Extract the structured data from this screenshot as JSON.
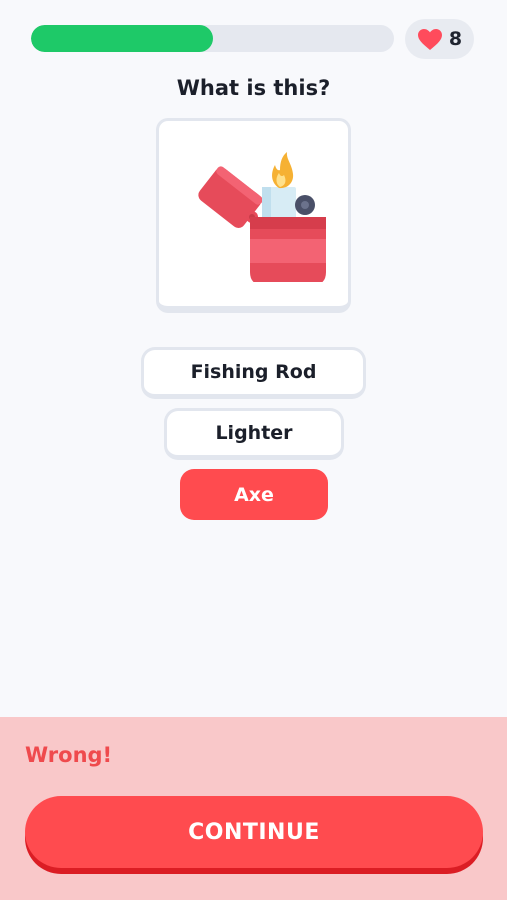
{
  "progress": {
    "fraction": 0.5,
    "fill_color": "#1ec968"
  },
  "lives": {
    "icon": "heart-icon",
    "count": "8"
  },
  "question": {
    "text": "What is this?"
  },
  "image": {
    "icon": "lighter-icon"
  },
  "answers": [
    {
      "label": "Fishing Rod",
      "state": "neutral"
    },
    {
      "label": "Lighter",
      "state": "neutral"
    },
    {
      "label": "Axe",
      "state": "wrong"
    }
  ],
  "feedback": {
    "message": "Wrong!",
    "continue_label": "CONTINUE"
  },
  "colors": {
    "correct_green": "#1ec968",
    "wrong_red": "#ff4b4f",
    "feedback_bg": "#f9c8c9"
  }
}
